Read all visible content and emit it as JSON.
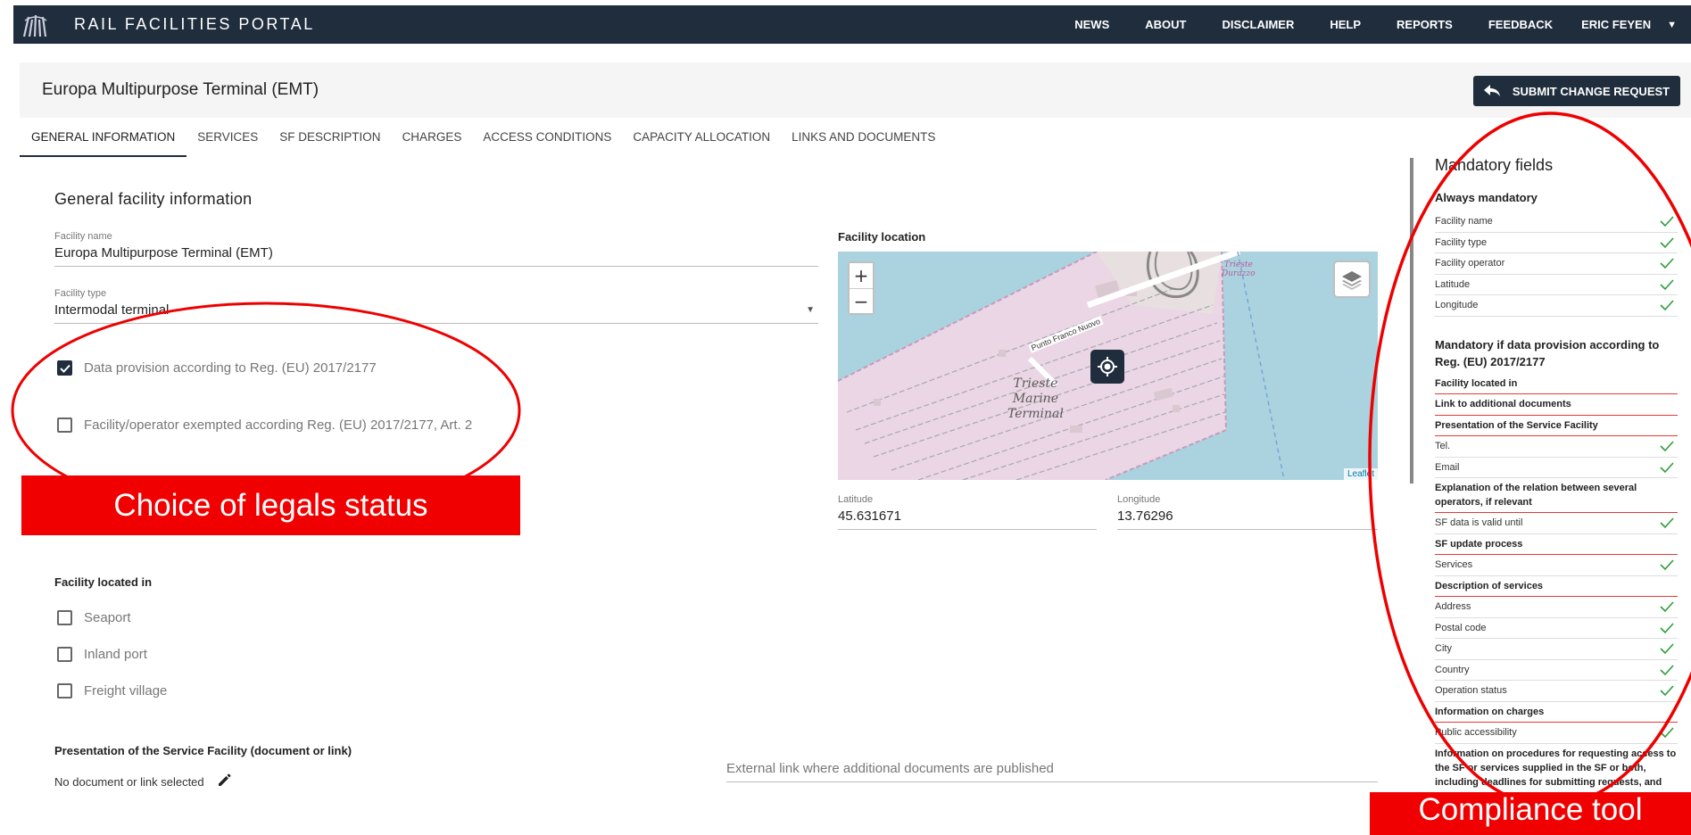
{
  "nav": {
    "brand": "RAIL FACILITIES PORTAL",
    "items": [
      "NEWS",
      "ABOUT",
      "DISCLAIMER",
      "HELP",
      "REPORTS",
      "FEEDBACK"
    ],
    "user": "ERIC FEYEN"
  },
  "header": {
    "title": "Europa Multipurpose Terminal (EMT)",
    "submit_label": "SUBMIT CHANGE REQUEST"
  },
  "tabs": [
    "GENERAL INFORMATION",
    "SERVICES",
    "SF DESCRIPTION",
    "CHARGES",
    "ACCESS CONDITIONS",
    "CAPACITY ALLOCATION",
    "LINKS AND DOCUMENTS"
  ],
  "form": {
    "section_title": "General facility information",
    "facility_name_label": "Facility name",
    "facility_name": "Europa Multipurpose Terminal (EMT)",
    "facility_type_label": "Facility type",
    "facility_type": "Intermodal terminal",
    "check_data_provision": "Data provision according to Reg. (EU) 2017/2177",
    "check_exempted": "Facility/operator exempted according Reg. (EU) 2017/2177, Art. 2",
    "located_in_heading": "Facility located in",
    "located_options": [
      "Seaport",
      "Inland port",
      "Freight village"
    ],
    "presentation_heading": "Presentation of the Service Facility (document or link)",
    "no_document": "No document or link selected",
    "external_link_placeholder": "External link where additional documents are published"
  },
  "map": {
    "title": "Facility location",
    "zoom_in": "+",
    "zoom_out": "−",
    "label_terminal": "Trieste\nMarine\nTerminal",
    "label_street": "Punto Franco Nuovo",
    "label_durazzo": "Trieste\nDurazzo",
    "attribution": "Leaflet",
    "latitude_label": "Latitude",
    "latitude": "45.631671",
    "longitude_label": "Longitude",
    "longitude": "13.76296"
  },
  "compliance": {
    "title": "Mandatory fields",
    "always_heading": "Always mandatory",
    "always": [
      {
        "label": "Facility name",
        "ok": true
      },
      {
        "label": "Facility type",
        "ok": true
      },
      {
        "label": "Facility operator",
        "ok": true
      },
      {
        "label": "Latitude",
        "ok": true
      },
      {
        "label": "Longitude",
        "ok": true
      }
    ],
    "conditional_heading": "Mandatory if data provision according to Reg. (EU) 2017/2177",
    "conditional": [
      {
        "label": "Facility located in",
        "ok": false
      },
      {
        "label": "Link to additional documents",
        "ok": false
      },
      {
        "label": "Presentation of the Service Facility",
        "ok": false
      },
      {
        "label": "Tel.",
        "ok": true
      },
      {
        "label": "Email",
        "ok": true
      },
      {
        "label": "Explanation of the relation between several operators, if relevant",
        "ok": false
      },
      {
        "label": "SF data is valid until",
        "ok": true
      },
      {
        "label": "SF update process",
        "ok": false
      },
      {
        "label": "Services",
        "ok": true
      },
      {
        "label": "Description of services",
        "ok": false
      },
      {
        "label": "Address",
        "ok": true
      },
      {
        "label": "Postal code",
        "ok": true
      },
      {
        "label": "City",
        "ok": true
      },
      {
        "label": "Country",
        "ok": true
      },
      {
        "label": "Operation status",
        "ok": true
      },
      {
        "label": "Information on charges",
        "ok": false
      },
      {
        "label": "Public accessibility",
        "ok": true
      },
      {
        "label": "Information on procedures for requesting access to the SF or services supplied in the SF or both, including deadlines for submitting requests, and",
        "ok": false
      }
    ]
  },
  "annotations": {
    "legal_status": "Choice of legals status",
    "compliance_tool": "Compliance tool",
    "color": "#f00000"
  }
}
